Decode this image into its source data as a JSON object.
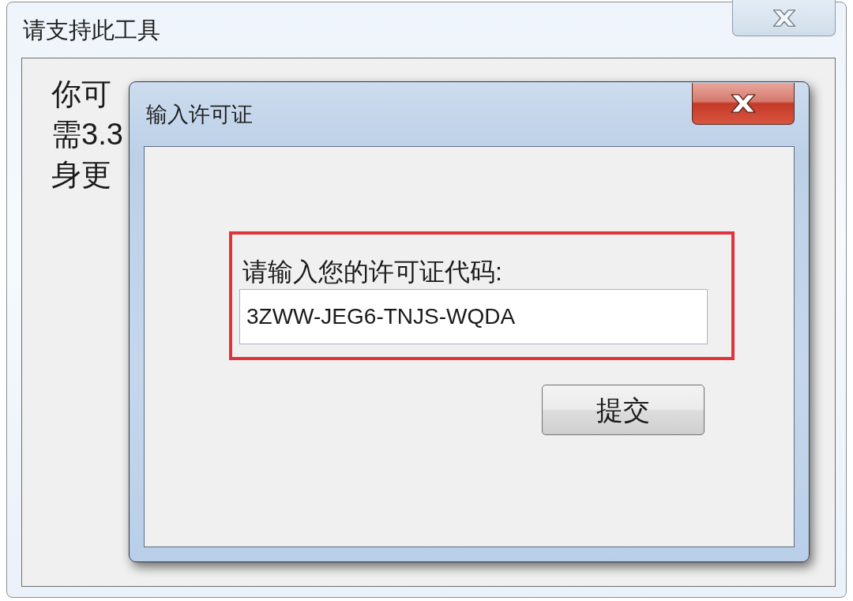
{
  "background_window": {
    "title": "请支持此工具",
    "body_lines": [
      "你可",
      "需3.3",
      "身更"
    ]
  },
  "dialog": {
    "title": "输入许可证",
    "prompt": "请输入您的许可证代码:",
    "license_field": {
      "value": "3ZWW-JEG6-TNJS-WQDA"
    },
    "buttons": [
      "提交"
    ]
  }
}
